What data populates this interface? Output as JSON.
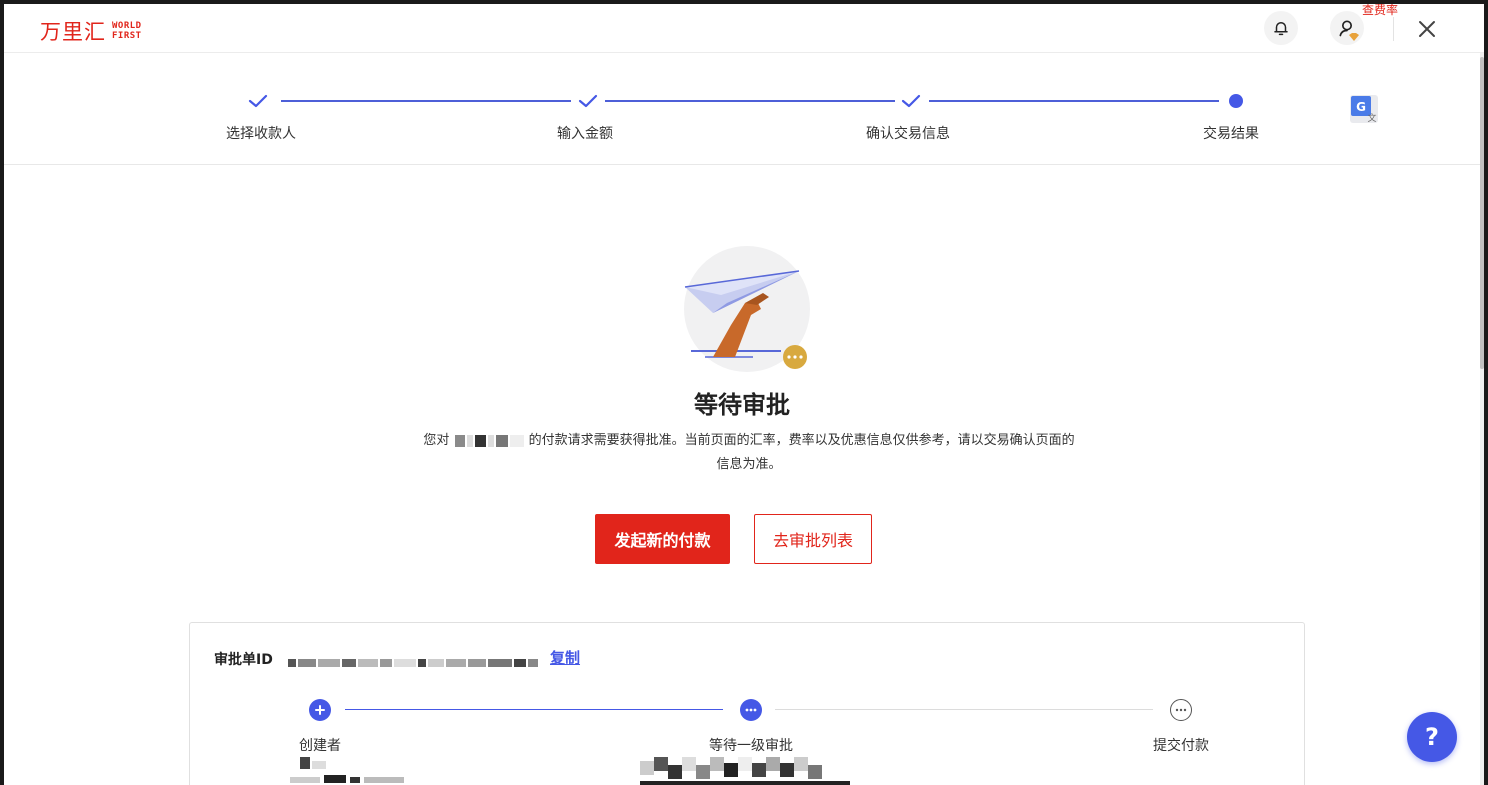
{
  "brand": {
    "name_cn": "万里汇",
    "name_en_line1": "WORLD",
    "name_en_line2": "FIRST",
    "accent": "#e1251b"
  },
  "header": {
    "rate_badge": "查费率",
    "icons": [
      "bell-icon",
      "user-icon",
      "close-icon"
    ]
  },
  "stepper": {
    "steps": [
      {
        "label": "选择收款人",
        "state": "done"
      },
      {
        "label": "输入金额",
        "state": "done"
      },
      {
        "label": "确认交易信息",
        "state": "done"
      },
      {
        "label": "交易结果",
        "state": "current"
      }
    ],
    "color": "#4558e6"
  },
  "result": {
    "title": "等待审批",
    "desc_prefix": "您对",
    "desc_suffix": "的付款请求需要获得批准。当前页面的汇率，费率以及优惠信息仅供参考，请以交易确认页面的信息为准。",
    "primary_button": "发起新的付款",
    "secondary_button": "去审批列表"
  },
  "approval_card": {
    "id_label": "审批单ID",
    "copy_label": "复制",
    "flow": [
      {
        "label": "创建者",
        "state": "done"
      },
      {
        "label": "等待一级审批",
        "state": "current"
      },
      {
        "label": "提交付款",
        "state": "pending"
      }
    ]
  },
  "help": {
    "label": "?"
  }
}
